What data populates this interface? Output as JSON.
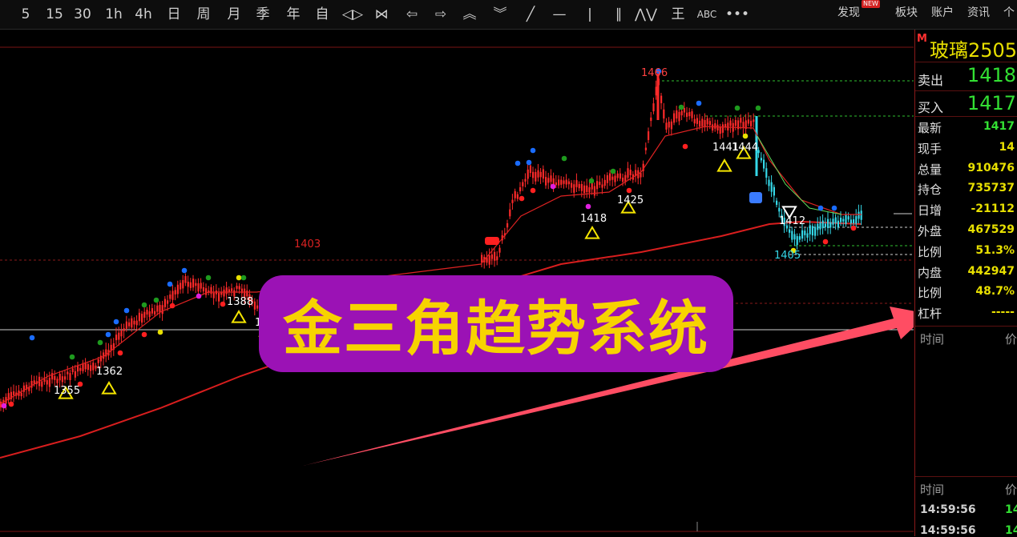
{
  "toolbar": {
    "periods": [
      "5",
      "15",
      "30",
      "1h",
      "4h",
      "日",
      "周",
      "月",
      "季",
      "年",
      "自"
    ],
    "tools": [
      {
        "name": "prev-icon",
        "glyph": "◁▷"
      },
      {
        "name": "fit-icon",
        "glyph": "⋈"
      },
      {
        "name": "arrow-left-icon",
        "glyph": "⇦"
      },
      {
        "name": "arrow-right-icon",
        "glyph": "⇨"
      },
      {
        "name": "zoom-in-icon",
        "glyph": "︽"
      },
      {
        "name": "zoom-out-icon",
        "glyph": "︾"
      },
      {
        "name": "trend-line-icon",
        "glyph": "╱"
      },
      {
        "name": "horizontal-line-icon",
        "glyph": "—"
      },
      {
        "name": "vertical-line-icon",
        "glyph": "|"
      },
      {
        "name": "parallel-line-icon",
        "glyph": "∥"
      },
      {
        "name": "wave-icon",
        "glyph": "⋀⋁"
      },
      {
        "name": "fibonacci-icon",
        "glyph": "王"
      },
      {
        "name": "text-tool-icon",
        "glyph": "ABC"
      },
      {
        "name": "more-icon",
        "glyph": "•••"
      }
    ],
    "right_links": [
      "发现",
      "板块",
      "账户",
      "资讯",
      "个"
    ],
    "new_badge": "NEW"
  },
  "chart": {
    "price_labels": [
      "1466",
      "1441",
      "1444",
      "1425",
      "1418",
      "1412",
      "1405",
      "1403",
      "1388",
      "1362",
      "1355",
      "1"
    ],
    "banner_text": "金三角趋势系统",
    "colors": {
      "up": "#ff2a2a",
      "down": "#35d8e8",
      "ma": "#d81e1e",
      "triangle": "#f5e600",
      "banner_bg": "#9b12b5",
      "banner_text": "#f7d300",
      "arrow": "#ff4d63"
    }
  },
  "quote": {
    "market_flag": "M",
    "title": "玻璃2505",
    "ask_label": "卖出",
    "ask": "1418",
    "bid_label": "买入",
    "bid": "1417",
    "stats": [
      {
        "label": "最新",
        "value": "1417",
        "color": "#33e033"
      },
      {
        "label": "现手",
        "value": "14",
        "color": "#e8e000"
      },
      {
        "label": "总量",
        "value": "910476",
        "color": "#e8e000"
      },
      {
        "label": "持仓",
        "value": "735737",
        "color": "#e8e000"
      },
      {
        "label": "日增",
        "value": "-21112",
        "color": "#e8e000"
      },
      {
        "label": "外盘",
        "value": "467529",
        "color": "#e8e000"
      },
      {
        "label": "比例",
        "value": "51.3%",
        "color": "#e8e000"
      },
      {
        "label": "内盘",
        "value": "442947",
        "color": "#e8e000"
      },
      {
        "label": "比例",
        "value": "48.7%",
        "color": "#e8e000"
      },
      {
        "label": "杠杆",
        "value": "-----",
        "color": "#e8e000"
      }
    ],
    "ticks_header": {
      "time": "时间",
      "price": "价"
    },
    "ticks_header2": {
      "time": "时间",
      "price": "价"
    },
    "ticks": [
      {
        "time": "14:59:56",
        "price": "14"
      },
      {
        "time": "14:59:56",
        "price": "14"
      }
    ]
  }
}
